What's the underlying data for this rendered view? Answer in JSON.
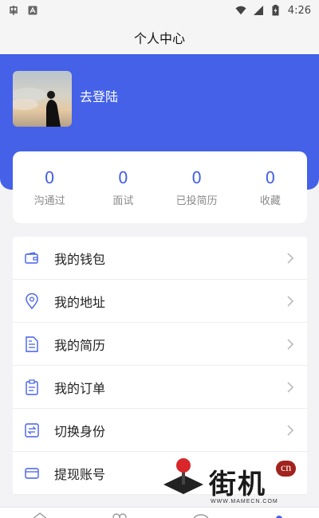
{
  "status_bar": {
    "time": "4:26",
    "icons": [
      "app-notification-icon",
      "text-a-icon",
      "wifi-icon",
      "signal-icon",
      "battery-icon"
    ]
  },
  "header": {
    "title": "个人中心"
  },
  "profile": {
    "login_label": "去登陆"
  },
  "stats": [
    {
      "value": "0",
      "label": "沟通过"
    },
    {
      "value": "0",
      "label": "面试"
    },
    {
      "value": "0",
      "label": "已投简历"
    },
    {
      "value": "0",
      "label": "收藏"
    }
  ],
  "menu": [
    {
      "label": "我的钱包",
      "icon": "wallet-icon"
    },
    {
      "label": "我的地址",
      "icon": "location-pin-icon"
    },
    {
      "label": "我的简历",
      "icon": "resume-document-icon"
    },
    {
      "label": "我的订单",
      "icon": "order-clipboard-icon"
    },
    {
      "label": "切换身份",
      "icon": "switch-arrows-icon"
    },
    {
      "label": "提现账号",
      "icon": "card-icon"
    }
  ],
  "watermark": {
    "text": "街机",
    "badge": "cn",
    "url": "WWW.MAMECN.COM"
  },
  "colors": {
    "accent": "#4461e8",
    "background": "#f3f3f5",
    "card": "#ffffff",
    "badge": "#a2231e"
  }
}
